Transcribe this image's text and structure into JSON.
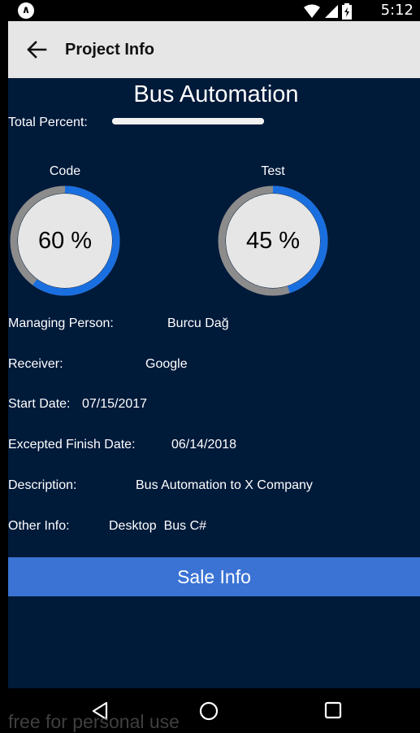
{
  "status_bar": {
    "time": "5:12"
  },
  "app_bar": {
    "title": "Project Info"
  },
  "project": {
    "name": "Bus Automation",
    "total_percent_label": "Total Percent:",
    "total_percent": 1.0
  },
  "gauges": [
    {
      "label": "Code",
      "value_text": "60 %",
      "percent": 60,
      "progress_color": "#1a6fe0",
      "track_color": "#8c8c8c"
    },
    {
      "label": "Test",
      "value_text": "45 %",
      "percent": 45,
      "progress_color": "#1a6fe0",
      "track_color": "#8c8c8c"
    }
  ],
  "info": {
    "managing_person": {
      "label": "Managing Person:",
      "value": "Burcu Dağ"
    },
    "receiver": {
      "label": "Receiver:",
      "value": "Google"
    },
    "start_date": {
      "label": "Start Date:",
      "value": "07/15/2017"
    },
    "finish_date": {
      "label": "Excepted Finish Date:",
      "value": "06/14/2018"
    },
    "description": {
      "label": "Description:",
      "value": "Bus Automation to X Company"
    },
    "other_info": {
      "label": "Other Info:",
      "value": "Desktop  Bus C#"
    }
  },
  "sale_button": {
    "label": "Sale Info"
  },
  "watermark": "free for personal use",
  "colors": {
    "background": "#001a3a",
    "accent": "#3a73d4",
    "app_bar": "#e6e6e6"
  }
}
